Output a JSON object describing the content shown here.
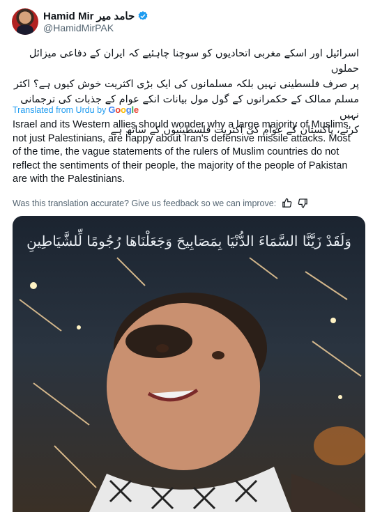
{
  "author": {
    "display_name": "Hamid Mir",
    "display_name_urdu": "حامد میر",
    "handle": "@HamidMirPAK"
  },
  "post": {
    "urdu_lines": [
      "اسرائیل اور اسکے مغربی اتحادیوں کو سوچنا چاہئیے کہ ایران کے دفاعی میزائل حملوں",
      "پر صرف فلسطینی نہیں بلکہ مسلمانوں کی ایک بڑی اکثریت خوش کیوں ہے؟ اکثر",
      "مسلم ممالک کے حکمرانوں کے گول مول بیانات انکے عوام کے جذبات کی ترجمانی نہیں",
      "کرتے، پاکستان کے عوام کی اکثریت فلسطینیوں کے ساتھ ہے"
    ],
    "translated_label": "Translated from Urdu by",
    "google_letters": [
      "G",
      "o",
      "o",
      "g",
      "l",
      "e"
    ],
    "english_text": "Israel and its Western allies should wonder why a large majority of Muslims, not just Palestinians, are happy about Iran's defensive missile attacks. Most of the time, the vague statements of the rulers of Muslim countries do not reflect the sentiments of their people, the majority of the people of Pakistan are with the Palestinians.",
    "feedback_prompt": "Was this translation accurate? Give us feedback so we can improve:"
  },
  "media": {
    "calligraphy": "وَلَقَدْ زَيَّنَّا السَّمَاءَ الدُّنْيَا بِمَصَابِيحَ وَجَعَلْنَاهَا رُجُومًا لِّلشَّيَاطِينِ"
  },
  "icons": {
    "verified": "verified-badge-icon",
    "thumbs_up": "thumbs-up-icon",
    "thumbs_down": "thumbs-down-icon"
  },
  "colors": {
    "accent": "#1d9bf0",
    "secondary_text": "#536471",
    "primary_text": "#0f1419"
  }
}
